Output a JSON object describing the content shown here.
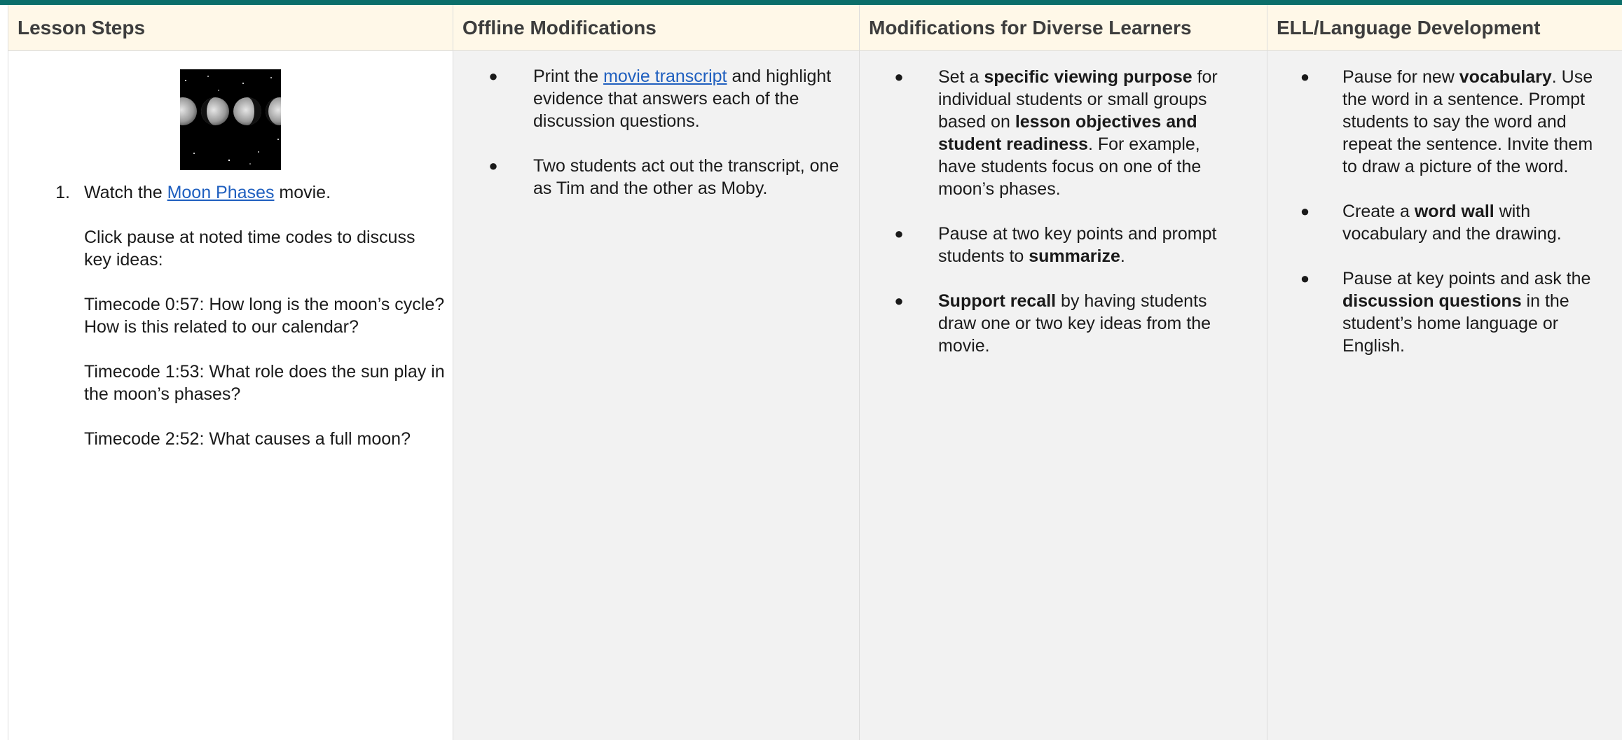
{
  "headers": {
    "lesson_steps": "Lesson Steps",
    "offline": "Offline Modifications",
    "diverse": "Modifications for Diverse Learners",
    "ell": "ELL/Language Development"
  },
  "lesson_steps": {
    "step_number": "1.",
    "watch_prefix": "Watch the ",
    "movie_link": "Moon Phases",
    "watch_suffix": " movie.",
    "pause_instruction": "Click pause at noted time codes to discuss key ideas:",
    "timecode_1": "Timecode 0:57: How long is the moon’s cycle? How is this related to our calendar?",
    "timecode_2": "Timecode 1:53: What role does the sun play in the moon’s phases?",
    "timecode_3": "Timecode 2:52: What causes a full moon?"
  },
  "offline": {
    "item1_prefix": "Print the ",
    "item1_link": "movie transcript",
    "item1_suffix": " and highlight evidence that answers each of the discussion questions.",
    "item2": "Two students act out the transcript, one as Tim and the other as Moby."
  },
  "diverse": {
    "item1_a": "Set a ",
    "item1_b": "specific viewing purpose",
    "item1_c": " for individual students or small groups based on ",
    "item1_d": "lesson objectives and student readiness",
    "item1_e": ". For example, have students focus on one of the moon’s phases.",
    "item2_a": "Pause at two key points and prompt students to ",
    "item2_b": "summarize",
    "item2_c": ".",
    "item3_a": "Support recall",
    "item3_b": " by having students draw one or two key ideas from the movie."
  },
  "ell": {
    "item1_a": "Pause for new ",
    "item1_b": "vocabulary",
    "item1_c": ". Use the word in a sentence. Prompt students to say the word and repeat the sentence. Invite them to draw a picture of the word.",
    "item2_a": "Create a ",
    "item2_b": "word wall",
    "item2_c": " with vocabulary and the drawing.",
    "item3_a": "Pause at key points and ask the ",
    "item3_b": "discussion questions",
    "item3_c": " in the student’s home language or English."
  },
  "bullet": "●",
  "colors": {
    "accent": "#0b6e6a",
    "header_bg": "#fff8e8",
    "link": "#1f5fbf",
    "cell_gray": "#f2f2f2"
  }
}
